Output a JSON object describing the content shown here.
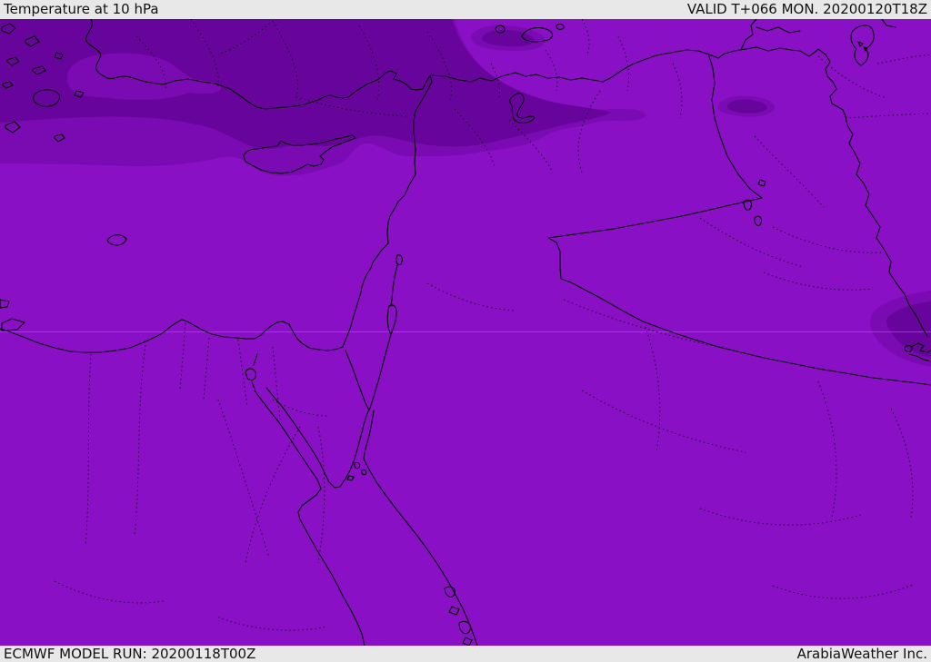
{
  "header": {
    "title": "Temperature at 10 hPa",
    "valid_label": "VALID T+066 MON. 20200120T18Z"
  },
  "footer": {
    "model_run_label": "ECMWF MODEL RUN: 20200118T00Z",
    "provider_label": "ArabiaWeather Inc."
  },
  "map": {
    "parameter": "Temperature at 10 hPa",
    "model": "ECMWF",
    "region": "Eastern Mediterranean / Middle East",
    "shading_levels": [
      "dark-violet (coldest band, north)",
      "medium-purple (transition band)",
      "bright-purple (base, south)"
    ]
  },
  "css_vars": {
    "--c-base": "#8a10c6",
    "--c-mid": "#7a0bb2",
    "--c-dark": "#67049b",
    "--c-grid": "#b062da",
    "--c-line": "#000000",
    "--c-bar": "#e8e8e8",
    "--c-text": "#111111"
  }
}
